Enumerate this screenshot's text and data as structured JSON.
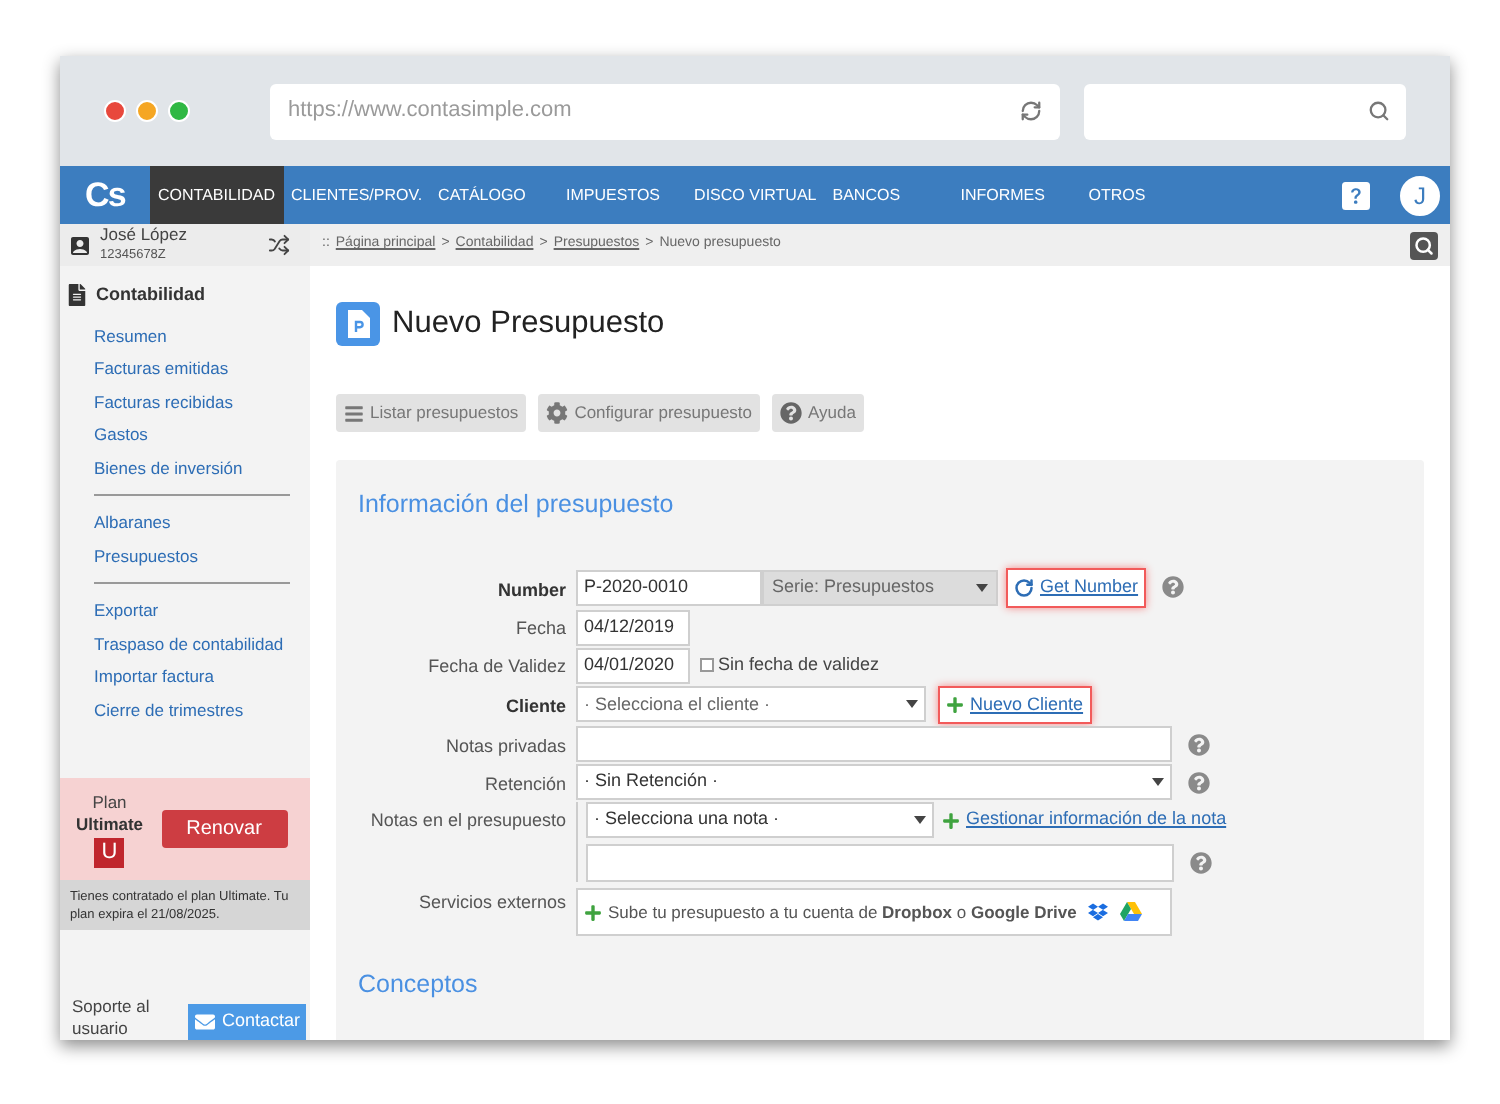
{
  "browser": {
    "url": "https://www.contasimple.com"
  },
  "navbar": {
    "logo": "Cs",
    "items": [
      {
        "label": "CONTABILIDAD",
        "selected": true
      },
      {
        "label": "CLIENTES/PROV.",
        "selected": false
      },
      {
        "label": "CATÁLOGO",
        "selected": false
      },
      {
        "label": "IMPUESTOS",
        "selected": false
      },
      {
        "label": "DISCO VIRTUAL",
        "selected": false
      },
      {
        "label": "BANCOS",
        "selected": false
      },
      {
        "label": "INFORMES",
        "selected": false
      },
      {
        "label": "OTROS",
        "selected": false
      }
    ],
    "avatar": "J"
  },
  "sidebar": {
    "user": {
      "name": "José López",
      "id": "12345678Z"
    },
    "section": "Contabilidad",
    "groups": [
      {
        "items": [
          "Resumen",
          "Facturas emitidas",
          "Facturas recibidas",
          "Gastos",
          "Bienes de inversión"
        ]
      },
      {
        "items": [
          "Albaranes",
          "Presupuestos"
        ]
      },
      {
        "items": [
          "Exportar",
          "Traspaso de contabilidad",
          "Importar factura",
          "Cierre de trimestres"
        ]
      }
    ],
    "plan": {
      "label": "Plan",
      "name": "Ultimate",
      "badge": "U",
      "button": "Renovar",
      "note": "Tienes contratado el plan Ultimate. Tu plan expira el 21/08/2025."
    },
    "support": {
      "label": "Soporte al usuario",
      "button": "Contactar"
    }
  },
  "breadcrumb": {
    "prefix": "::",
    "separator": ">",
    "links": [
      "Página principal",
      "Contabilidad",
      "Presupuestos"
    ],
    "current": "Nuevo presupuesto"
  },
  "page_title": "Nuevo Presupuesto",
  "toolbar": [
    {
      "kind": "list",
      "label": "Listar presupuestos"
    },
    {
      "kind": "settings",
      "label": "Configurar presupuesto"
    },
    {
      "kind": "help",
      "label": "Ayuda"
    }
  ],
  "form": {
    "title": "Información del presupuesto",
    "rows": [
      {
        "kind": "number",
        "label": "Number",
        "required": true,
        "value": "P-2020-0010",
        "series": "Serie: Presupuestos",
        "link": "Get Number",
        "highlighted": true
      },
      {
        "kind": "date",
        "label": "Fecha",
        "required": false,
        "value": "04/12/2019"
      },
      {
        "kind": "date",
        "label": "Fecha de Validez",
        "required": false,
        "value": "04/01/2020",
        "checkbox": {
          "label": "Sin fecha de validez",
          "checked": false
        }
      },
      {
        "kind": "client",
        "label": "Cliente",
        "required": true,
        "value": "· Selecciona el cliente ·",
        "link": "Nuevo Cliente",
        "highlighted": true
      },
      {
        "kind": "textarea",
        "label": "Notas privadas",
        "required": false
      },
      {
        "kind": "select",
        "label": "Retención",
        "required": false,
        "value": "· Sin Retención ·"
      },
      {
        "kind": "notes",
        "label": "Notas en el presupuesto",
        "required": false,
        "value": "· Selecciona una nota ·",
        "link": "Gestionar información de la nota",
        "highlighted": false
      },
      {
        "kind": "services",
        "label": "Servicios externos",
        "required": false,
        "value": "Sube tu presupuesto a tu cuenta de **Dropbox** o **Google Drive**"
      }
    ]
  },
  "next_section": "Conceptos"
}
